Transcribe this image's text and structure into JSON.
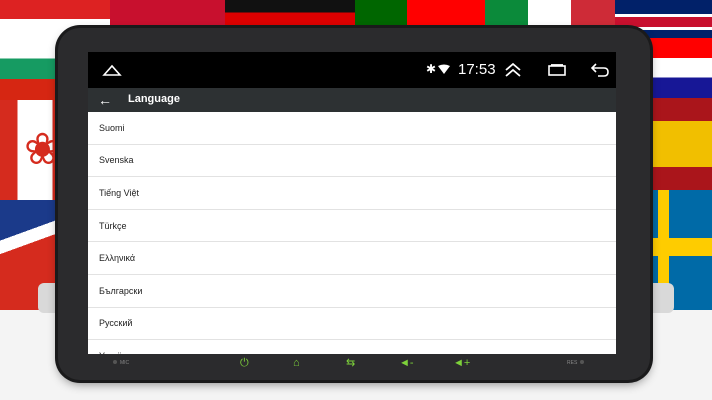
{
  "status_bar": {
    "time": "17:53",
    "bluetooth_icon": "✱",
    "icons": [
      "home-outline-icon",
      "bluetooth-icon",
      "wifi-icon",
      "expand-up-icon",
      "recent-apps-icon",
      "back-icon"
    ]
  },
  "app_bar": {
    "title": "Language",
    "back_glyph": "←"
  },
  "languages": [
    "Suomi",
    "Svenska",
    "Tiếng Việt",
    "Türkçe",
    "Ελληνικά",
    "Български",
    "Русский",
    "Українська"
  ],
  "bezel": {
    "mic_label": "MIC",
    "reset_label": "RES",
    "buttons": [
      "power-icon",
      "home-icon",
      "back-icon",
      "volume-down-icon",
      "volume-up-icon"
    ],
    "power_glyph": "⏻",
    "home_glyph": "⌂",
    "back_glyph": "⇆",
    "vol_down_glyph": "◄-",
    "vol_up_glyph": "◄+",
    "accent": "#7dd23a"
  }
}
